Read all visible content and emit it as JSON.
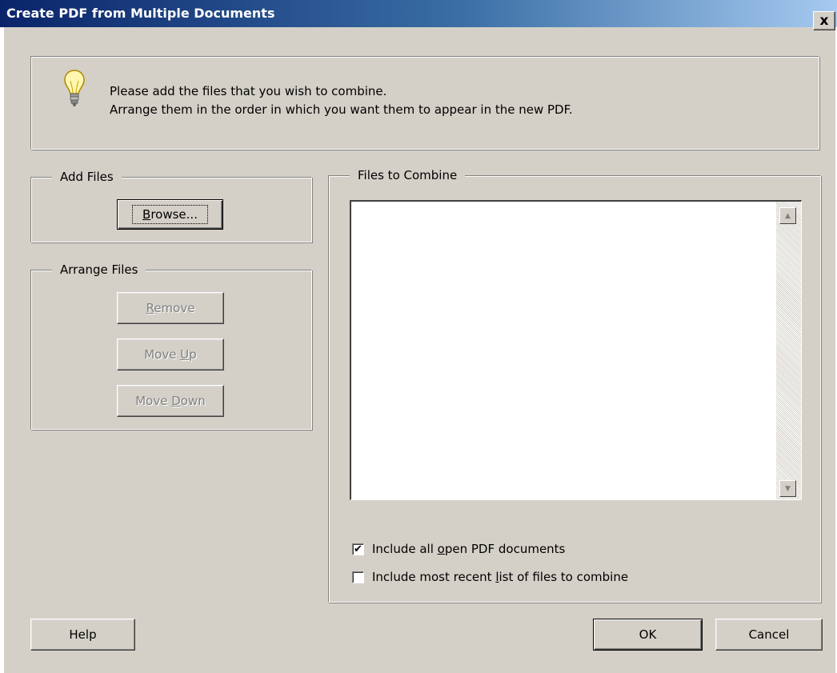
{
  "window": {
    "title": "Create PDF from Multiple Documents",
    "close_label": "x"
  },
  "info": {
    "icon": "lightbulb-icon",
    "line1": "Please add the files that you wish to combine.",
    "line2": "Arrange them in the order in which you want them to appear in the new PDF."
  },
  "add_files": {
    "label": "Add Files",
    "browse_prefix": "",
    "browse_accel": "B",
    "browse_rest": "rowse..."
  },
  "arrange_files": {
    "label": "Arrange Files",
    "remove_accel": "R",
    "remove_rest": "emove",
    "moveup_prefix": "Move ",
    "moveup_accel": "U",
    "moveup_rest": "p",
    "movedown_prefix": "Move ",
    "movedown_accel": "D",
    "movedown_rest": "own"
  },
  "files_to_combine": {
    "label": "Files to Combine",
    "items": []
  },
  "options": {
    "include_open_prefix": "Include all ",
    "include_open_accel": "o",
    "include_open_rest": "pen PDF documents",
    "include_open_checked": true,
    "include_recent_prefix": "Include most recent ",
    "include_recent_accel": "l",
    "include_recent_rest": "ist of files to combine",
    "include_recent_checked": false
  },
  "footer": {
    "help": "Help",
    "ok": "OK",
    "cancel": "Cancel"
  },
  "colors": {
    "dialog_bg": "#d4d0c8",
    "title_gradient_start": "#0a246a",
    "title_gradient_end": "#a6caf0"
  }
}
